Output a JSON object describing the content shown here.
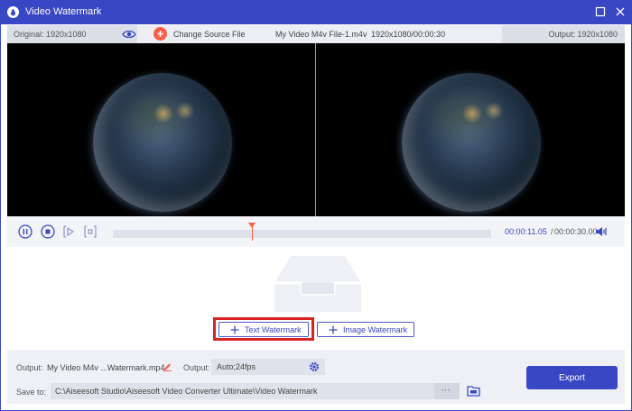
{
  "window": {
    "title": "Video Watermark",
    "accent_color": "#3a47c5",
    "highlight_color": "#d92222"
  },
  "infobar": {
    "original_label": "Original: 1920x1080",
    "change_source_label": "Change Source File",
    "file_name": "My Video M4v File-1.m4v",
    "file_meta": "1920x1080/00:00:30",
    "output_label": "Output: 1920x1080"
  },
  "playback": {
    "current_time": "00:00:11.05",
    "separator": "/",
    "total_time": "00:00:30.00",
    "progress_fraction": 0.367
  },
  "watermark": {
    "text_watermark_label": "Text Watermark",
    "image_watermark_label": "Image Watermark"
  },
  "bottom": {
    "output_label": "Output:",
    "output_file": "My Video M4v ...Watermark.mp4",
    "format_label": "Output:",
    "format_value": "Auto;24fps",
    "save_to_label": "Save to:",
    "save_path": "C:\\Aiseesoft Studio\\Aiseesoft Video Converter Ultimate\\Video Watermark",
    "browse_label": "···",
    "export_label": "Export"
  },
  "icons": [
    "app-logo-icon",
    "maximize-icon",
    "close-icon",
    "eye-icon",
    "plus-icon",
    "pause-icon",
    "stop-icon",
    "prev-frame-icon",
    "next-frame-icon",
    "volume-icon",
    "inbox-icon",
    "edit-icon",
    "gear-icon",
    "folder-icon"
  ]
}
